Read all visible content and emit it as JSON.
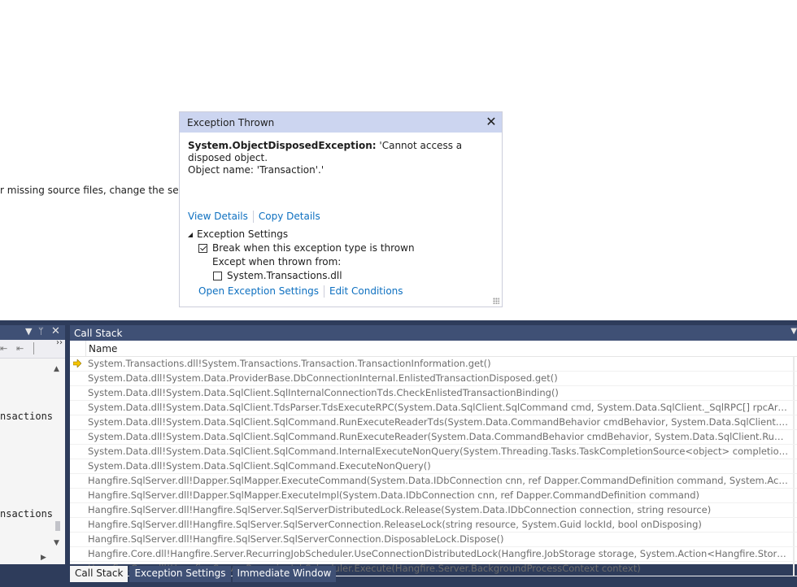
{
  "background_hint": "r missing source files, change the setting i",
  "exception_popup": {
    "title": "Exception Thrown",
    "exception_type": "System.ObjectDisposedException:",
    "exception_message": "'Cannot access a disposed object.",
    "exception_message_2": "Object name: 'Transaction'.'",
    "view_details": "View Details",
    "copy_details": "Copy Details",
    "settings_header": "Exception Settings",
    "break_when_thrown": "Break when this exception type is thrown",
    "break_when_thrown_checked": true,
    "except_when_thrown_from": "Except when thrown from:",
    "transactions_dll": "System.Transactions.dll",
    "transactions_dll_checked": false,
    "open_exception_settings": "Open Exception Settings",
    "edit_conditions": "Edit Conditions"
  },
  "left_panel": {
    "text_1": "nsactions",
    "text_2": "nsactions"
  },
  "call_stack": {
    "title": "Call Stack",
    "column_name": "Name",
    "current_frame_color": "#f5c400",
    "rows": [
      "System.Transactions.dll!System.Transactions.Transaction.TransactionInformation.get()",
      "System.Data.dll!System.Data.ProviderBase.DbConnectionInternal.EnlistedTransactionDisposed.get()",
      "System.Data.dll!System.Data.SqlClient.SqlInternalConnectionTds.CheckEnlistedTransactionBinding()",
      "System.Data.dll!System.Data.SqlClient.TdsParser.TdsExecuteRPC(System.Data.SqlClient.SqlCommand cmd, System.Data.SqlClient._SqlRPC[] rpcArray, int timeout, ...",
      "System.Data.dll!System.Data.SqlClient.SqlCommand.RunExecuteReaderTds(System.Data.CommandBehavior cmdBehavior, System.Data.SqlClient.RunBehavior run...",
      "System.Data.dll!System.Data.SqlClient.SqlCommand.RunExecuteReader(System.Data.CommandBehavior cmdBehavior, System.Data.SqlClient.RunBehavior runBeh...",
      "System.Data.dll!System.Data.SqlClient.SqlCommand.InternalExecuteNonQuery(System.Threading.Tasks.TaskCompletionSource<object> completion, string metho...",
      "System.Data.dll!System.Data.SqlClient.SqlCommand.ExecuteNonQuery()",
      "Hangfire.SqlServer.dll!Dapper.SqlMapper.ExecuteCommand(System.Data.IDbConnection cnn, ref Dapper.CommandDefinition command, System.Action<System....",
      "Hangfire.SqlServer.dll!Dapper.SqlMapper.ExecuteImpl(System.Data.IDbConnection cnn, ref Dapper.CommandDefinition command)",
      "Hangfire.SqlServer.dll!Hangfire.SqlServer.SqlServerDistributedLock.Release(System.Data.IDbConnection connection, string resource)",
      "Hangfire.SqlServer.dll!Hangfire.SqlServer.SqlServerConnection.ReleaseLock(string resource, System.Guid lockId, bool onDisposing)",
      "Hangfire.SqlServer.dll!Hangfire.SqlServer.SqlServerConnection.DisposableLock.Dispose()",
      "Hangfire.Core.dll!Hangfire.Server.RecurringJobScheduler.UseConnectionDistributedLock(Hangfire.JobStorage storage, System.Action<Hangfire.Storage.IStorageC...",
      "Hangfire.Core.dll!Hangfire.Server.RecurringJobScheduler.Execute(Hangfire.Server.BackgroundProcessContext context)"
    ]
  },
  "bottom_tabs": {
    "call_stack": "Call Stack",
    "exception_settings": "Exception Settings",
    "immediate_window": "Immediate Window"
  }
}
